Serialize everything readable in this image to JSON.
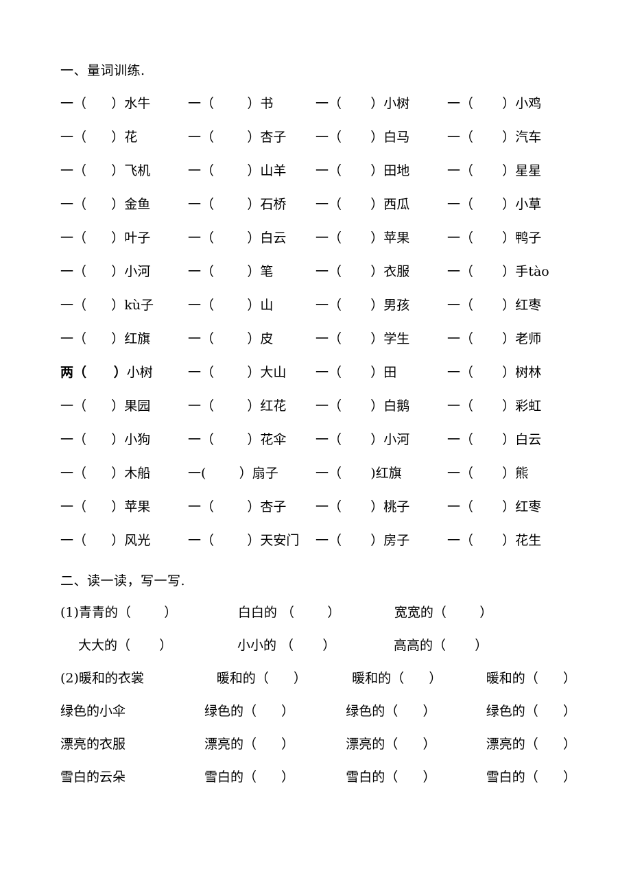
{
  "document": {
    "section_one": {
      "heading": "一、量词训练.",
      "rows": [
        [
          {
            "num": "一",
            "open": "（",
            "close": "）",
            "word": "水牛"
          },
          {
            "num": "一",
            "open": "（",
            "close": "）",
            "word": "书"
          },
          {
            "num": "一",
            "open": "（",
            "close": "）",
            "word": "小树"
          },
          {
            "num": "一",
            "open": "（",
            "close": "）",
            "word": "小鸡"
          }
        ],
        [
          {
            "num": "一",
            "open": "（",
            "close": "）",
            "word": "花"
          },
          {
            "num": "一",
            "open": "（",
            "close": "）",
            "word": "杏子"
          },
          {
            "num": "一",
            "open": "（",
            "close": "）",
            "word": "白马"
          },
          {
            "num": "一",
            "open": "（",
            "close": "）",
            "word": "汽车"
          }
        ],
        [
          {
            "num": "一",
            "open": "（",
            "close": "）",
            "word": "飞机"
          },
          {
            "num": "一",
            "open": "（",
            "close": "）",
            "word": "山羊"
          },
          {
            "num": "一",
            "open": "（",
            "close": "）",
            "word": "田地"
          },
          {
            "num": "一",
            "open": "（",
            "close": "）",
            "word": "星星"
          }
        ],
        [
          {
            "num": "一",
            "open": "（",
            "close": "）",
            "word": "金鱼"
          },
          {
            "num": "一",
            "open": "（",
            "close": "）",
            "word": "石桥"
          },
          {
            "num": "一",
            "open": "（",
            "close": "）",
            "word": "西瓜"
          },
          {
            "num": "一",
            "open": "（",
            "close": "）",
            "word": "小草"
          }
        ],
        [
          {
            "num": "一",
            "open": "（",
            "close": "）",
            "word": "叶子"
          },
          {
            "num": "一",
            "open": "（",
            "close": "）",
            "word": "白云"
          },
          {
            "num": "一",
            "open": "（",
            "close": "）",
            "word": "苹果"
          },
          {
            "num": "一",
            "open": "（",
            "close": "）",
            "word": "鸭子"
          }
        ],
        [
          {
            "num": "一",
            "open": "（",
            "close": "）",
            "word": "小河"
          },
          {
            "num": "一",
            "open": "（",
            "close": "）",
            "word": "笔"
          },
          {
            "num": "一",
            "open": "（",
            "close": "）",
            "word": "衣服"
          },
          {
            "num": "一",
            "open": "（",
            "close": "）",
            "word": "手tào"
          }
        ],
        [
          {
            "num": "一",
            "open": "（",
            "close": "）",
            "word": "kù子"
          },
          {
            "num": "一",
            "open": "（",
            "close": "）",
            "word": "山"
          },
          {
            "num": "一",
            "open": "（",
            "close": "）",
            "word": "男孩"
          },
          {
            "num": "一",
            "open": "（",
            "close": "）",
            "word": "红枣"
          }
        ],
        [
          {
            "num": "一",
            "open": "（",
            "close": "）",
            "word": "红旗"
          },
          {
            "num": "一",
            "open": "（",
            "close": "）",
            "word": "皮"
          },
          {
            "num": "一",
            "open": "（",
            "close": "）",
            "word": "学生"
          },
          {
            "num": "一",
            "open": "（",
            "close": "）",
            "word": "老师"
          }
        ],
        [
          {
            "num": "两",
            "open": "（",
            "close": "）",
            "word": "小树",
            "bold_paren": true
          },
          {
            "num": "一",
            "open": "（",
            "close": "）",
            "word": "大山"
          },
          {
            "num": "一",
            "open": "（",
            "close": "）",
            "word": "田"
          },
          {
            "num": "一",
            "open": "（",
            "close": "）",
            "word": "树林"
          }
        ],
        [
          {
            "num": "一",
            "open": "（",
            "close": "）",
            "word": "果园"
          },
          {
            "num": "一",
            "open": "（",
            "close": "）",
            "word": "红花"
          },
          {
            "num": "一",
            "open": "（",
            "close": "）",
            "word": "白鹅"
          },
          {
            "num": "一",
            "open": "（",
            "close": "）",
            "word": "彩虹"
          }
        ],
        [
          {
            "num": "一",
            "open": "（",
            "close": "）",
            "word": "小狗"
          },
          {
            "num": "一",
            "open": "（",
            "close": "）",
            "word": "花伞"
          },
          {
            "num": "一",
            "open": "（",
            "close": "）",
            "word": "小河"
          },
          {
            "num": "一",
            "open": "（",
            "close": "）",
            "word": "白云"
          }
        ],
        [
          {
            "num": "一",
            "open": "（",
            "close": "）",
            "word": "木船"
          },
          {
            "num": "一",
            "open": "(",
            "close": "）",
            "word": "扇子"
          },
          {
            "num": "一",
            "open": "（",
            "close": ")",
            "word": "红旗"
          },
          {
            "num": "一",
            "open": "（",
            "close": "）",
            "word": "熊"
          }
        ],
        [
          {
            "num": "一",
            "open": "（",
            "close": "）",
            "word": "苹果"
          },
          {
            "num": "一",
            "open": "（",
            "close": "）",
            "word": "杏子"
          },
          {
            "num": "一",
            "open": "（",
            "close": "）",
            "word": "桃子"
          },
          {
            "num": "一",
            "open": "（",
            "close": "）",
            "word": "红枣"
          }
        ],
        [
          {
            "num": "一",
            "open": "（",
            "close": "）",
            "word": "风光"
          },
          {
            "num": "一",
            "open": "（",
            "close": "）",
            "word": "天安门"
          },
          {
            "num": "一",
            "open": "（",
            "close": "）",
            "word": "房子"
          },
          {
            "num": "一",
            "open": "（",
            "close": "）",
            "word": "花生"
          }
        ]
      ]
    },
    "section_two": {
      "heading": "二、读一读，写一写.",
      "item1_label": "(1)",
      "item2_label": "(2)",
      "rows": [
        {
          "label": "(1)",
          "indent": false,
          "cells": [
            "青青的（        ）",
            "白白的 （        ）",
            "宽宽的（        ）"
          ]
        },
        {
          "label": "",
          "indent": true,
          "cells": [
            "大大的（       ）",
            "小小的 （       ）",
            "高高的（       ）"
          ]
        },
        {
          "label": "(2)",
          "indent": false,
          "cells": [
            "暖和的衣裳",
            "暖和的（      ）",
            "暖和的（      ）",
            "暖和的（      ）"
          ]
        },
        {
          "label": "",
          "indent": false,
          "cells": [
            "绿色的小伞",
            "绿色的（      ）",
            "绿色的（      ）",
            "绿色的（      ）"
          ]
        },
        {
          "label": "",
          "indent": false,
          "cells": [
            "漂亮的衣服",
            "漂亮的（      ）",
            "漂亮的（      ）",
            "漂亮的（      ）"
          ]
        },
        {
          "label": "",
          "indent": false,
          "cells": [
            "雪白的云朵",
            "雪白的（      ）",
            "雪白的（      ）",
            "雪白的（      ）"
          ]
        }
      ]
    }
  }
}
